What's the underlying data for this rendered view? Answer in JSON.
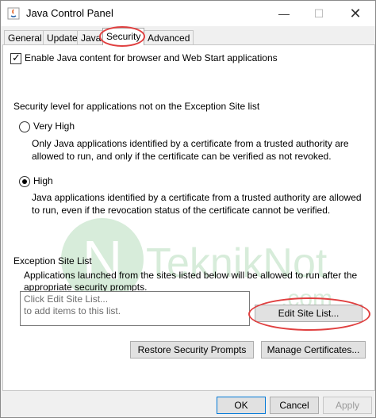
{
  "window": {
    "title": "Java Control Panel",
    "minimize_symbol": "—",
    "maximize_symbol": "☐",
    "close_symbol": "✕",
    "app_icon": "java-icon"
  },
  "tabs": [
    {
      "label": "General"
    },
    {
      "label": "Update"
    },
    {
      "label": "Java"
    },
    {
      "label": "Security"
    },
    {
      "label": "Advanced"
    }
  ],
  "security": {
    "enable_checkbox_label": "Enable Java content for browser and Web Start applications",
    "enable_checked": true,
    "level_heading": "Security level for applications not on the Exception Site list",
    "very_high": {
      "label": "Very High",
      "desc_line1": "Only Java applications identified by a certificate from a trusted authority are",
      "desc_line2": "allowed to run, and only if the certificate can be verified as not revoked.",
      "selected": false
    },
    "high": {
      "label": "High",
      "desc_line1": "Java applications identified by a certificate from a trusted authority are allowed",
      "desc_line2": "to run, even if the revocation status of the certificate cannot be verified.",
      "selected": true
    },
    "exception": {
      "heading": "Exception Site List",
      "desc_line1": "Applications launched from the sites listed below will be allowed to run after the",
      "desc_line2": "appropriate security prompts.",
      "list_placeholder_line1": "Click Edit Site List...",
      "list_placeholder_line2": "to add items to this list.",
      "edit_button": "Edit Site List..."
    },
    "restore_button": "Restore Security Prompts",
    "manage_button": "Manage Certificates..."
  },
  "footer": {
    "ok": "OK",
    "cancel": "Cancel",
    "apply": "Apply"
  },
  "watermark": {
    "logo_letter": "N",
    "text": "TeknikNot",
    "suffix": ".com"
  },
  "colors": {
    "annotation": "#e04040",
    "focus_border": "#0078d7",
    "watermark": "#2a9a3a"
  }
}
